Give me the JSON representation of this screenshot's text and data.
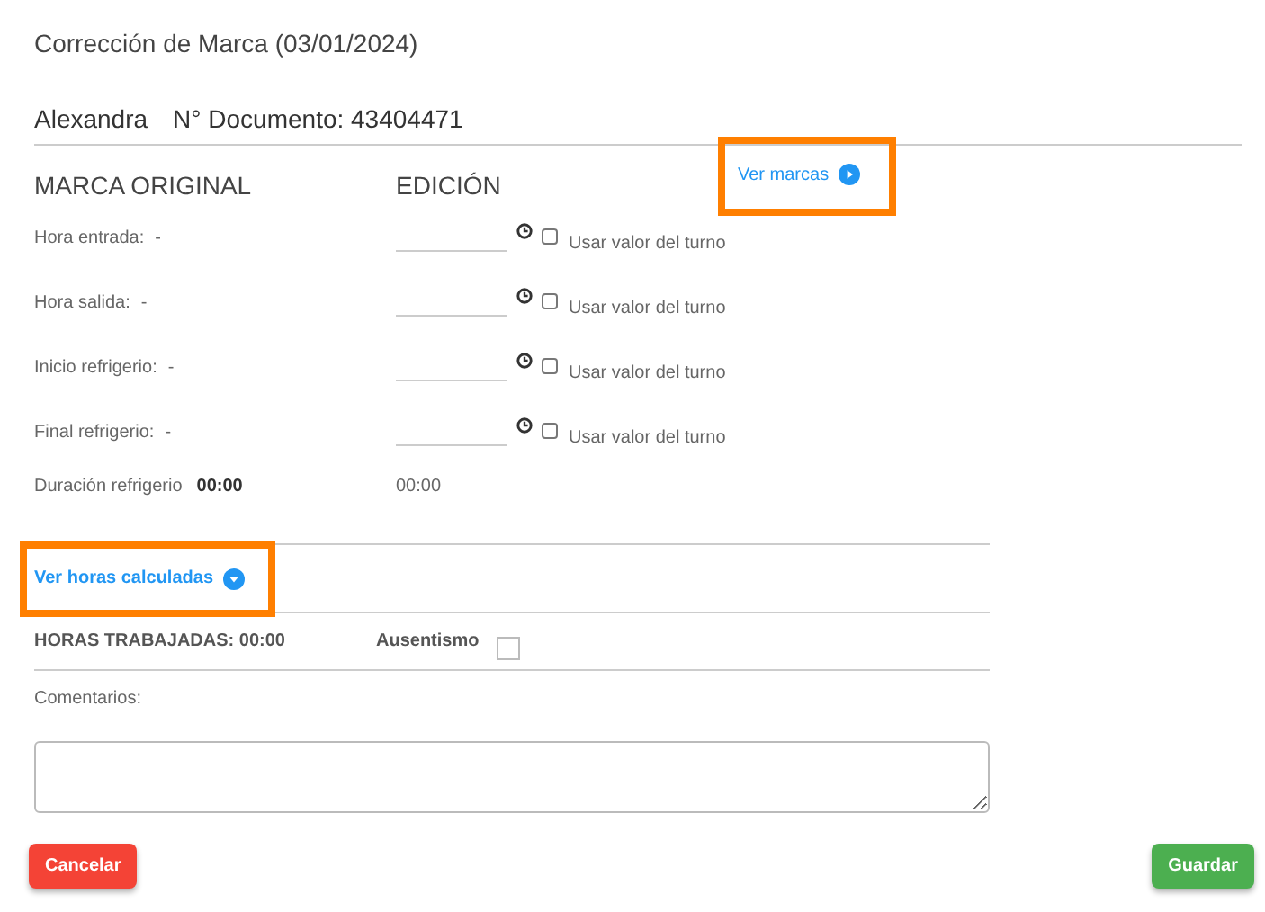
{
  "dialog": {
    "title": "Corrección de Marca (03/01/2024)",
    "employee_name": "Alexandra",
    "document": "N° Documento: 43404471"
  },
  "original_heading": "MARCA ORIGINAL",
  "edit_heading": "EDICIÓN",
  "view_marks_link": {
    "label": "Ver marcas",
    "highlighted": true
  },
  "marks": [
    {
      "label": "Hora entrada:",
      "original": "-",
      "use_shift_label": "Usar valor del turno",
      "checked": false
    },
    {
      "label": "Hora salida:",
      "original": "-",
      "use_shift_label": "Usar valor del turno",
      "checked": false
    },
    {
      "label": "Inicio refrigerio:",
      "original": "-",
      "use_shift_label": "Usar valor del turno",
      "checked": false
    },
    {
      "label": "Final refrigerio:",
      "original": "-",
      "use_shift_label": "Usar valor del turno",
      "checked": false
    }
  ],
  "break_duration": {
    "label": "Duración refrigerio",
    "original": "00:00",
    "edited": "00:00"
  },
  "calculated_hours_link": {
    "label": "Ver horas calculadas",
    "highlighted": true
  },
  "hours_worked": "HORAS TRABAJADAS: 00:00",
  "absence": {
    "label": "Ausentismo",
    "checked": false
  },
  "comments": {
    "label": "Comentarios:"
  },
  "buttons": [
    {
      "label": "Cancelar",
      "kind": "cancel"
    },
    {
      "label": "Guardar",
      "kind": "save"
    }
  ]
}
